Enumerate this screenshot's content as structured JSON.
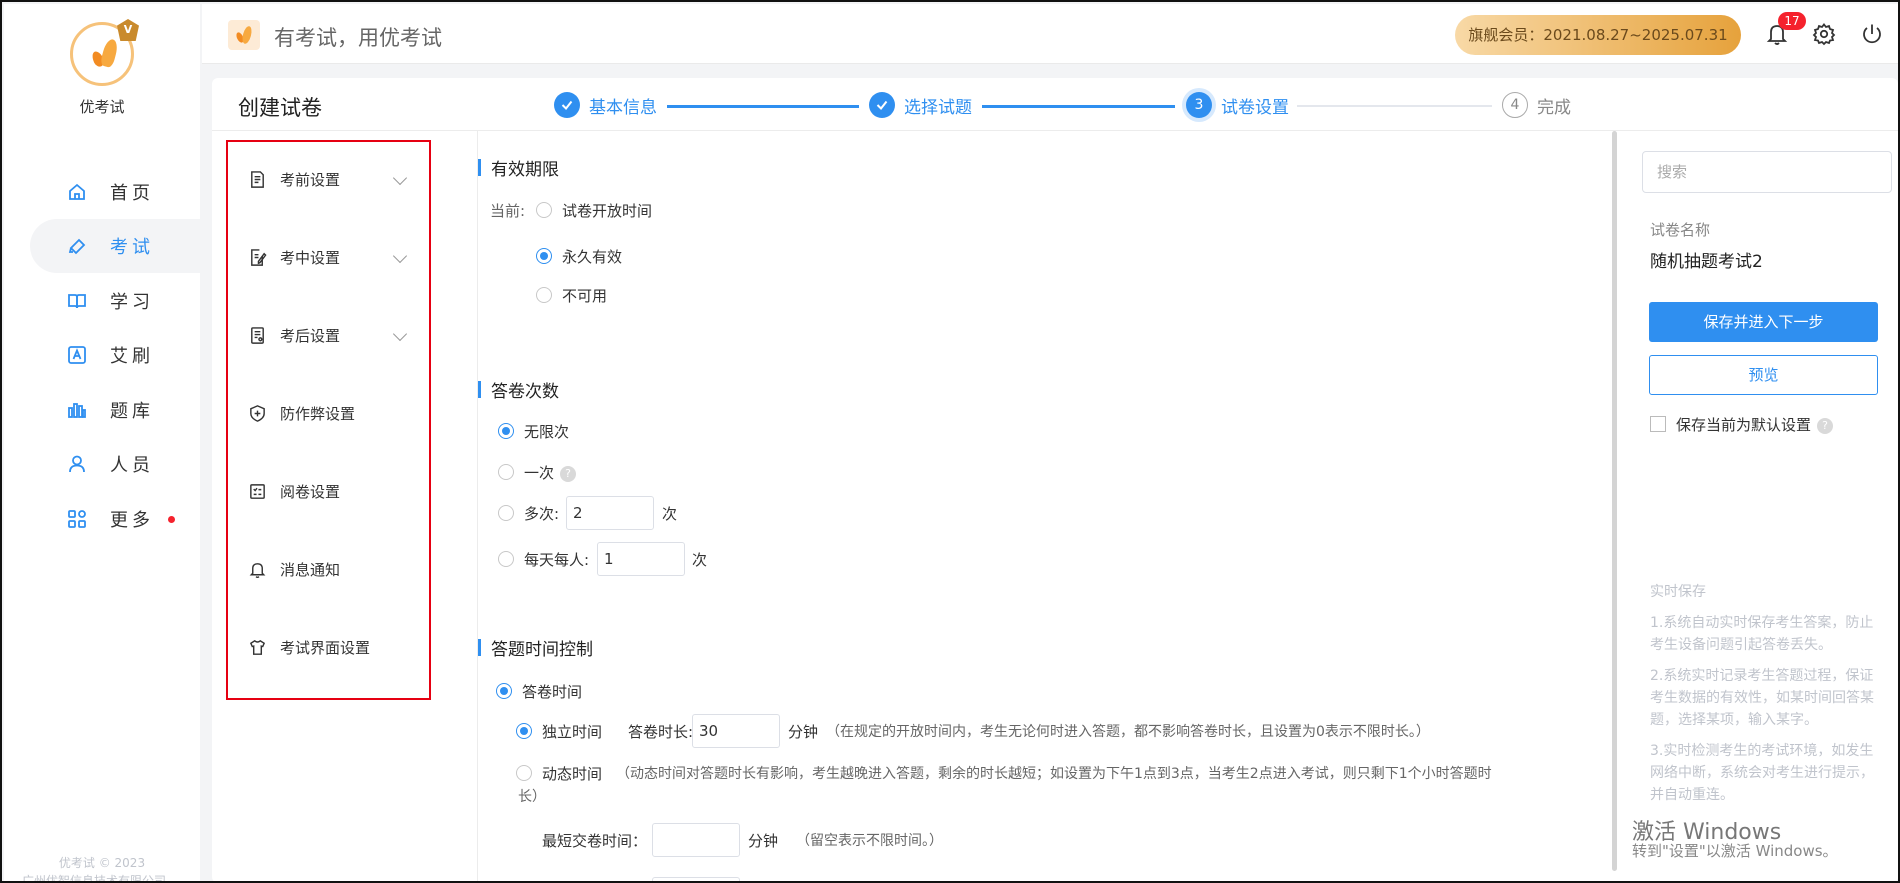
{
  "sidebar": {
    "brand": "优考试",
    "items": [
      {
        "label": "首页",
        "icon": "home-icon"
      },
      {
        "label": "考试",
        "icon": "tag-icon"
      },
      {
        "label": "学习",
        "icon": "book-icon"
      },
      {
        "label": "艾刷",
        "icon": "a-square-icon"
      },
      {
        "label": "题库",
        "icon": "bars-icon"
      },
      {
        "label": "人员",
        "icon": "user-icon"
      },
      {
        "label": "更多",
        "icon": "apps-icon"
      }
    ],
    "footer_copyright": "优考试 © 2023",
    "footer_company": "广州优智信息技术有限公司"
  },
  "header": {
    "slogan": "有考试，用优考试",
    "membership": "旗舰会员：2021.08.27~2025.07.31",
    "notification_count": "17"
  },
  "page": {
    "title": "创建试卷",
    "steps": [
      {
        "label": "基本信息",
        "state": "done"
      },
      {
        "label": "选择试题",
        "state": "done"
      },
      {
        "num": "3",
        "label": "试卷设置",
        "state": "current"
      },
      {
        "num": "4",
        "label": "完成",
        "state": "todo"
      }
    ]
  },
  "menu": {
    "items": [
      {
        "label": "考前设置",
        "icon": "document-icon"
      },
      {
        "label": "考中设置",
        "icon": "edit-document-icon"
      },
      {
        "label": "考后设置",
        "icon": "report-icon"
      },
      {
        "label": "防作弊设置",
        "icon": "shield-icon"
      },
      {
        "label": "阅卷设置",
        "icon": "checklist-icon"
      },
      {
        "label": "消息通知",
        "icon": "bell-icon"
      },
      {
        "label": "考试界面设置",
        "icon": "shirt-icon"
      }
    ]
  },
  "validity": {
    "title": "有效期限",
    "current_label": "当前:",
    "options": [
      "试卷开放时间",
      "永久有效",
      "不可用"
    ],
    "selected": "永久有效"
  },
  "attempts": {
    "title": "答卷次数",
    "unlimited": "无限次",
    "once": "一次",
    "multiple": "多次:",
    "multiple_value": "2",
    "per_day": "每天每人:",
    "per_day_value": "1",
    "unit": "次",
    "selected": "无限次"
  },
  "timing": {
    "title": "答题时间控制",
    "answer_time": "答卷时间",
    "independent": "独立时间",
    "duration_label": "答卷时长:",
    "duration_value": "30",
    "minutes": "分钟",
    "independent_note": "（在规定的开放时间内，考生无论何时进入答题，都不影响答卷时长，且设置为0表示不限时长。）",
    "dynamic": "动态时间",
    "dynamic_note_1": "（动态时间对答题时长有影响，考生越晚进入答题，剩余的时长越短；如设置为下午1点到3点，当考生2点进入考试，则只剩下1个小时答题时",
    "dynamic_note_2": "长）",
    "min_submit_label": "最短交卷时间：",
    "min_submit_value": "",
    "min_submit_note": "（留空表示不限时间。）"
  },
  "right_panel": {
    "search_placeholder": "搜索",
    "paper_name_label": "试卷名称",
    "paper_name": "随机抽题考试2",
    "save_next": "保存并进入下一步",
    "preview": "预览",
    "save_default": "保存当前为默认设置",
    "autosave_title": "实时保存",
    "autosave_1": "1.系统自动实时保存考生答案，防止考生设备问题引起答卷丢失。",
    "autosave_2": "2.系统实时记录考生答题过程，保证考生数据的有效性，如某时间回答某题，选择某项，输入某字。",
    "autosave_3": "3.实时检测考生的考试环境，如发生网络中断，系统会对考生进行提示，并自动重连。"
  },
  "os_watermark": {
    "line1": "激活 Windows",
    "line2": "转到\"设置\"以激活 Windows。"
  },
  "colors": {
    "accent": "#2f8ff0",
    "highlight_border": "#e60012",
    "badge": "#f5222d",
    "member_gold": "#e6a23c"
  }
}
